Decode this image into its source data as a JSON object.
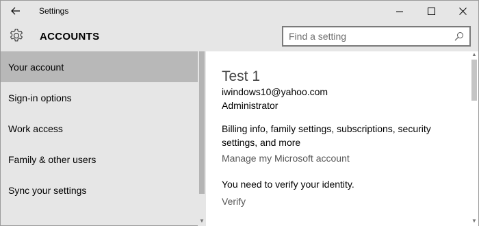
{
  "titlebar": {
    "title": "Settings",
    "back_icon": "back-arrow-icon"
  },
  "header": {
    "section_title": "ACCOUNTS",
    "icon": "gear-icon"
  },
  "search": {
    "placeholder": "Find a setting",
    "value": ""
  },
  "sidebar": {
    "items": [
      {
        "label": "Your account",
        "active": true
      },
      {
        "label": "Sign-in options",
        "active": false
      },
      {
        "label": "Work access",
        "active": false
      },
      {
        "label": "Family & other users",
        "active": false
      },
      {
        "label": "Sync your settings",
        "active": false
      }
    ]
  },
  "main": {
    "user_name": "Test 1",
    "email": "iwindows10@yahoo.com",
    "role": "Administrator",
    "billing_text": "Billing info, family settings, subscriptions, security settings, and more",
    "manage_link": "Manage my Microsoft account",
    "verify_message": "You need to verify your identity.",
    "verify_link": "Verify"
  },
  "colors": {
    "chrome_bg": "#e6e6e6",
    "selected_item_bg": "#b8b8b8",
    "content_bg": "#ffffff",
    "link_color": "#555555"
  }
}
